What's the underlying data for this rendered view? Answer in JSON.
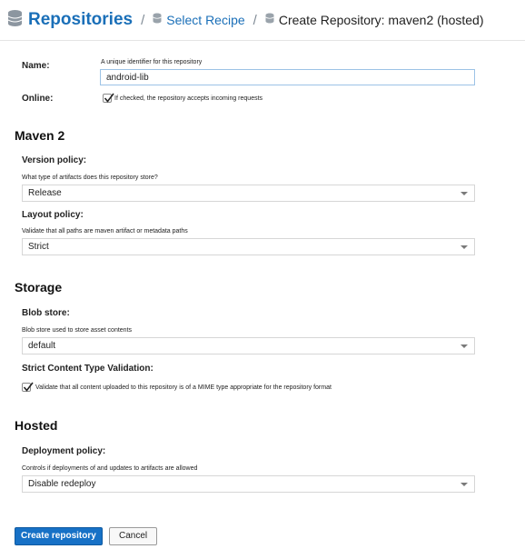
{
  "breadcrumb": {
    "title": "Repositories",
    "select_recipe": "Select Recipe",
    "current": "Create Repository: maven2 (hosted)"
  },
  "name_field": {
    "label": "Name:",
    "help": "A unique identifier for this repository",
    "value": "android-lib"
  },
  "online_field": {
    "label": "Online:",
    "checked": true,
    "help": "If checked, the repository accepts incoming requests"
  },
  "maven2": {
    "heading": "Maven 2",
    "version_policy": {
      "label": "Version policy:",
      "help": "What type of artifacts does this repository store?",
      "value": "Release"
    },
    "layout_policy": {
      "label": "Layout policy:",
      "help": "Validate that all paths are maven artifact or metadata paths",
      "value": "Strict"
    }
  },
  "storage": {
    "heading": "Storage",
    "blob_store": {
      "label": "Blob store:",
      "help": "Blob store used to store asset contents",
      "value": "default"
    },
    "strict_validation": {
      "label": "Strict Content Type Validation:",
      "checked": true,
      "help": "Validate that all content uploaded to this repository is of a MIME type appropriate for the repository format"
    }
  },
  "hosted": {
    "heading": "Hosted",
    "deployment_policy": {
      "label": "Deployment policy:",
      "help": "Controls if deployments of and updates to artifacts are allowed",
      "value": "Disable redeploy"
    }
  },
  "actions": {
    "create": "Create repository",
    "cancel": "Cancel"
  },
  "colors": {
    "link": "#1a6fb8",
    "primary_button": "#1771c6",
    "input_focus_border": "#9cc3e6"
  }
}
